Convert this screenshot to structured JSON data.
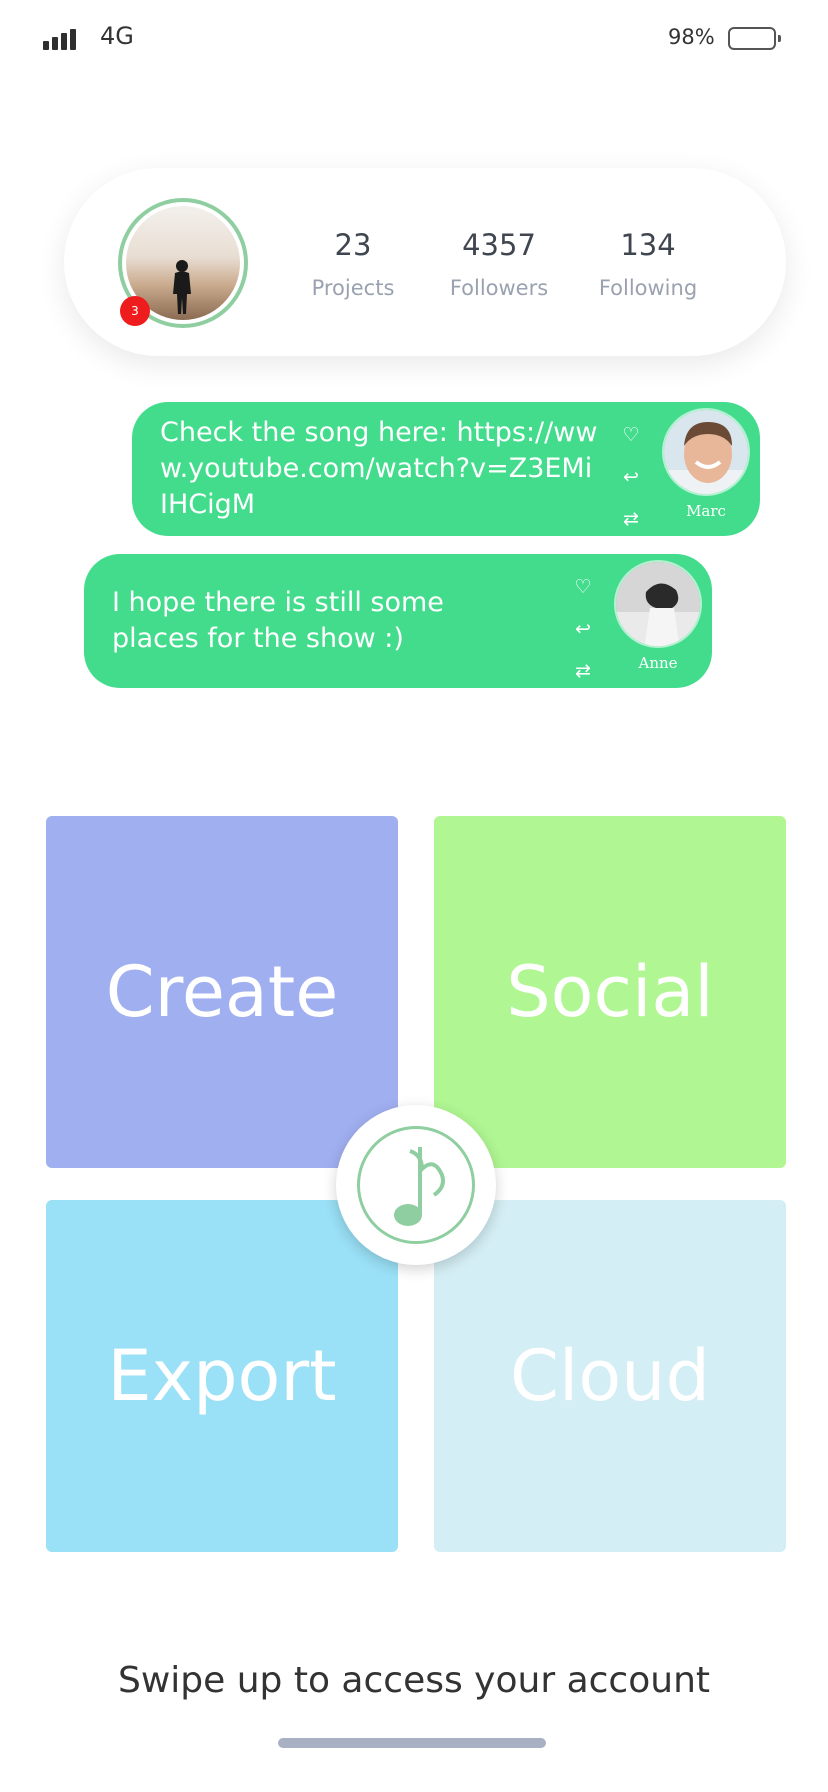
{
  "status_bar": {
    "network": "4G",
    "battery_percent": "98%",
    "battery_level": 0.98
  },
  "profile": {
    "notification_count": "3",
    "stats": [
      {
        "value": "23",
        "label": "Projects"
      },
      {
        "value": "4357",
        "label": "Followers"
      },
      {
        "value": "134",
        "label": "Following"
      }
    ]
  },
  "comments": [
    {
      "text": "Check the song here: https://www.youtube.com/watch?v=Z3EMiIHCigM",
      "author": "Marc",
      "actions": [
        "heart-icon",
        "reply-icon",
        "repost-icon"
      ]
    },
    {
      "text": "I hope there is still some places for the show :)",
      "author": "Anne",
      "actions": [
        "heart-icon",
        "reply-icon",
        "repost-icon"
      ]
    }
  ],
  "tiles": [
    {
      "label": "Create",
      "color": "#a0aff0"
    },
    {
      "label": "Social",
      "color": "#b0f692"
    },
    {
      "label": "Export",
      "color": "#9ae0f6"
    },
    {
      "label": "Cloud",
      "color": "#d3eef4"
    }
  ],
  "center_logo": {
    "icon": "music-note-icon",
    "color": "#8fcea0"
  },
  "footer": {
    "swipe_text": "Swipe up to access your account"
  },
  "colors": {
    "accent_green": "#43dc8d",
    "badge_red": "#ee1c1c"
  }
}
